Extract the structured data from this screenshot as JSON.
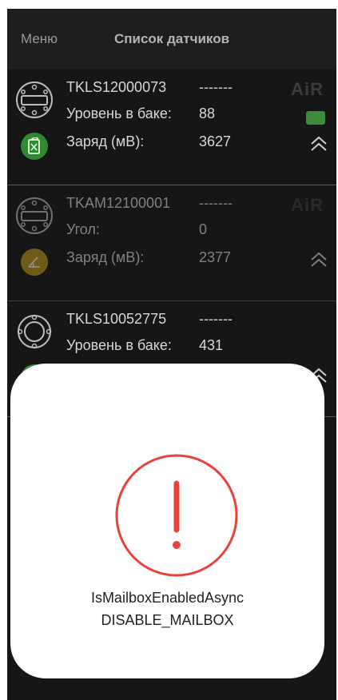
{
  "header": {
    "menu_label": "Меню",
    "title": "Список датчиков"
  },
  "sensors": [
    {
      "serial": "TKLS12000073",
      "status": "-------",
      "label1": "Уровень в баке:",
      "value1": "88",
      "label2": "Заряд (мВ):",
      "value2": "3627",
      "badge_icon": "fuel-tank-icon",
      "badge_color": "#2e8b2e",
      "brand": "AiR"
    },
    {
      "serial": "TKAM12100001",
      "status": "-------",
      "label1": "Угол:",
      "value1": "0",
      "label2": "Заряд (мВ):",
      "value2": "2377",
      "badge_icon": "angle-icon",
      "badge_color": "#a88a1a",
      "brand": "AiR"
    },
    {
      "serial": "TKLS10052775",
      "status": "-------",
      "label1": "Уровень в баке:",
      "value1": "431",
      "badge_icon": "fuel-tank-icon",
      "badge_color": "#2e8b2e"
    }
  ],
  "alert": {
    "line1": "IsMailboxEnabledAsync",
    "line2": "DISABLE_MAILBOX",
    "icon": "exclamation-icon",
    "accent": "#e8433a"
  }
}
